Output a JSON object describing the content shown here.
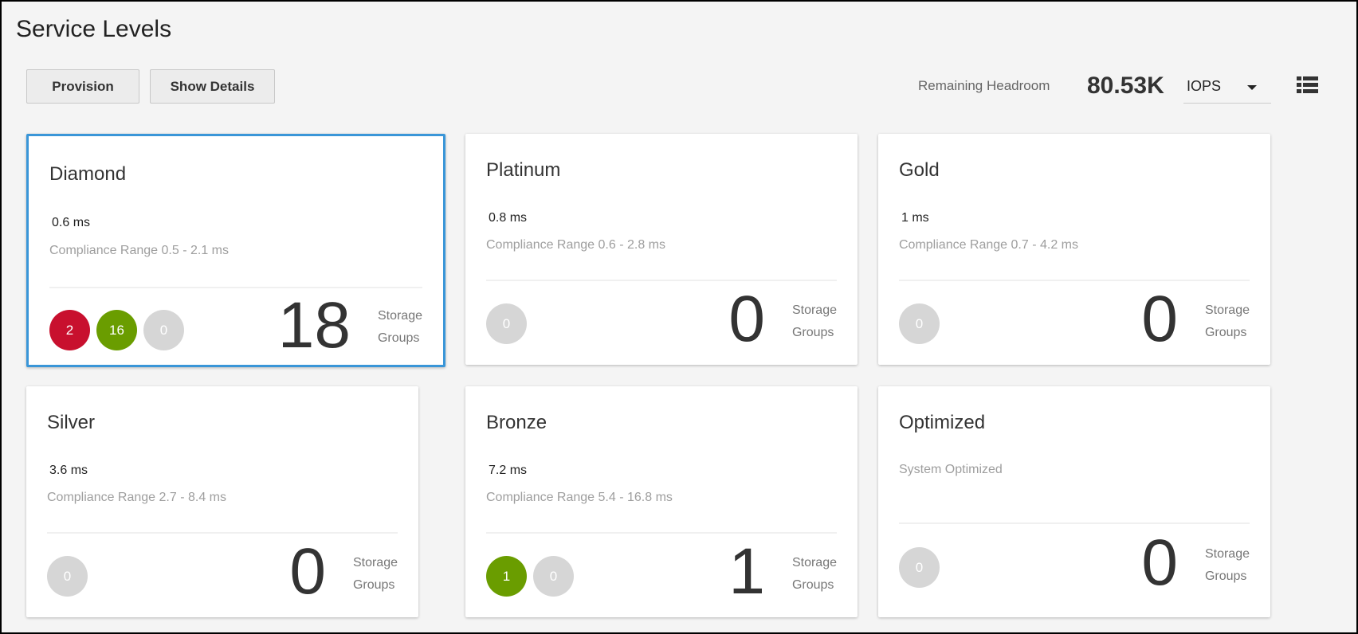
{
  "title": "Service Levels",
  "toolbar": {
    "provision": "Provision",
    "show_details": "Show Details"
  },
  "headroom": {
    "label": "Remaining Headroom",
    "value": "80.53K",
    "unit": "IOPS"
  },
  "colors": {
    "critical": "#c8102e",
    "ok": "#6a9d00",
    "none": "#d6d6d6",
    "selected_border": "#3a96d8"
  },
  "cards": [
    {
      "name": "Diamond",
      "latency": "0.6 ms",
      "range": "Compliance Range 0.5 - 2.1 ms",
      "count": "18",
      "count_label1": "Storage",
      "count_label2": "Groups",
      "badges": [
        {
          "v": "2",
          "s": "critical"
        },
        {
          "v": "16",
          "s": "ok"
        },
        {
          "v": "0",
          "s": "none"
        }
      ]
    },
    {
      "name": "Platinum",
      "latency": "0.8 ms",
      "range": "Compliance Range 0.6 - 2.8 ms",
      "count": "0",
      "count_label1": "Storage",
      "count_label2": "Groups",
      "badges": [
        {
          "v": "0",
          "s": "none"
        }
      ]
    },
    {
      "name": "Gold",
      "latency": "1 ms",
      "range": "Compliance Range 0.7 - 4.2 ms",
      "count": "0",
      "count_label1": "Storage",
      "count_label2": "Groups",
      "badges": [
        {
          "v": "0",
          "s": "none"
        }
      ]
    },
    {
      "name": "Silver",
      "latency": "3.6 ms",
      "range": "Compliance Range 2.7 - 8.4 ms",
      "count": "0",
      "count_label1": "Storage",
      "count_label2": "Groups",
      "badges": [
        {
          "v": "0",
          "s": "none"
        }
      ]
    },
    {
      "name": "Bronze",
      "latency": "7.2 ms",
      "range": "Compliance Range 5.4 - 16.8 ms",
      "count": "1",
      "count_label1": "Storage",
      "count_label2": "Groups",
      "badges": [
        {
          "v": "1",
          "s": "ok"
        },
        {
          "v": "0",
          "s": "none"
        }
      ]
    },
    {
      "name": "Optimized",
      "range": "System Optimized",
      "count": "0",
      "count_label1": "Storage",
      "count_label2": "Groups",
      "badges": [
        {
          "v": "0",
          "s": "none"
        }
      ]
    }
  ]
}
